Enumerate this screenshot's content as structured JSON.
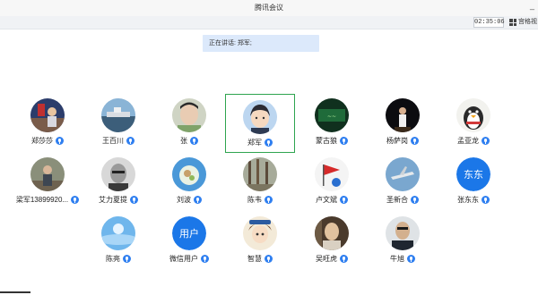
{
  "window": {
    "title": "腾讯会议",
    "minimize_glyph": "_"
  },
  "toolbar": {
    "timer": "02:35:06",
    "layout_label": "宫格视"
  },
  "speaking": {
    "text": "正在讲话: 郑军;"
  },
  "participants": [
    {
      "name": "郑莎莎",
      "avatar": "photo-street"
    },
    {
      "name": "王百川",
      "avatar": "photo-harbor"
    },
    {
      "name": "张",
      "avatar": "photo-face"
    },
    {
      "name": "郑军",
      "avatar": "cartoon-boy",
      "active": true
    },
    {
      "name": "蒙古狼",
      "avatar": "photo-dark-green"
    },
    {
      "name": "杨萨岗",
      "avatar": "photo-stage"
    },
    {
      "name": "孟亚龙",
      "avatar": "penguin"
    },
    {
      "name": "梁军13899920...",
      "avatar": "photo-outdoor"
    },
    {
      "name": "艾力夏提",
      "avatar": "photo-bw"
    },
    {
      "name": "刘波",
      "avatar": "photo-bubble"
    },
    {
      "name": "陈韦",
      "avatar": "photo-forest"
    },
    {
      "name": "卢文斌",
      "avatar": "photo-flag"
    },
    {
      "name": "圣新合",
      "avatar": "photo-jet"
    },
    {
      "name": "张东东",
      "avatar_text": "东东"
    },
    {
      "name": "陈亮",
      "avatar": "photo-sky"
    },
    {
      "name": "微信用户",
      "avatar_text": "用户"
    },
    {
      "name": "智慧",
      "avatar": "cartoon-girl"
    },
    {
      "name": "吴旺虎",
      "avatar": "photo-room"
    },
    {
      "name": "牛旭",
      "avatar": "photo-man"
    }
  ],
  "colors": {
    "accent": "#1b77e8",
    "active_border": "#2ea44f",
    "banner": "#dce9fb"
  }
}
